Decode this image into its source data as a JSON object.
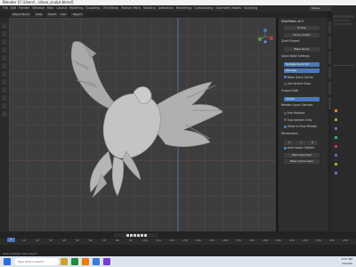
{
  "title_bar": {
    "title": "Blender [C:\\Users\\...\\dove_sculpt.blend]"
  },
  "menu": [
    "File",
    "Edit",
    "Render",
    "Window",
    "Help",
    "Layout",
    "Modeling",
    "Sculpting",
    "UV Editing",
    "Texture Paint",
    "Shading",
    "Animation",
    "Rendering",
    "Compositing",
    "Geometry Nodes",
    "Scripting"
  ],
  "scene_field": "Scene",
  "header_tools": [
    "Object Mode",
    "View",
    "Select",
    "Add",
    "Object"
  ],
  "npanel": {
    "title": "QuickTools v2.3",
    "rows": [
      {
        "type": "field",
        "label": "Scene",
        "value": "Scene"
      },
      {
        "type": "field",
        "label": "",
        "value": "Dove_Sculpt"
      },
      {
        "type": "label",
        "label": "Quick Export"
      },
      {
        "type": "button",
        "label": "Bake Quick"
      },
      {
        "type": "label",
        "label": "Quick Bake Settings"
      },
      {
        "type": "blue",
        "label": "Sample Count 64"
      },
      {
        "type": "blue",
        "label": "Denoise"
      },
      {
        "type": "check",
        "label": "Bake Quick Cache",
        "on": true
      },
      {
        "type": "check",
        "label": "Use Active Color",
        "on": false
      },
      {
        "type": "label",
        "label": "Output Path"
      },
      {
        "type": "blue",
        "label": "//bake/"
      },
      {
        "type": "label",
        "label": "Render Layer Controls"
      },
      {
        "type": "check",
        "label": "Use Holdout",
        "on": false
      },
      {
        "type": "check",
        "label": "Use Indirect Only",
        "on": false
      },
      {
        "type": "check",
        "label": "Show in Final Render",
        "on": true
      },
      {
        "type": "label",
        "label": "Dimensions"
      },
      {
        "type": "triple",
        "values": [
          "X",
          "Y",
          "Z"
        ]
      },
      {
        "type": "check",
        "label": "Auto Apply Objects",
        "on": true
      },
      {
        "type": "button",
        "label": "Bake Selected"
      },
      {
        "type": "button",
        "label": "Bake Cache Clear"
      }
    ]
  },
  "timeline": {
    "frame": "1",
    "ticks": [
      "0",
      "10",
      "20",
      "30",
      "40",
      "50",
      "60",
      "70",
      "80",
      "90",
      "100",
      "110",
      "120",
      "130",
      "140",
      "150",
      "160",
      "170",
      "180",
      "190",
      "200",
      "210",
      "220",
      "230",
      "240",
      "250"
    ]
  },
  "status": {
    "text": "Select   Rotate View   Object"
  },
  "taskbar": {
    "search_placeholder": "Type here to search",
    "time": "6:57 PM",
    "date": "Climate"
  }
}
